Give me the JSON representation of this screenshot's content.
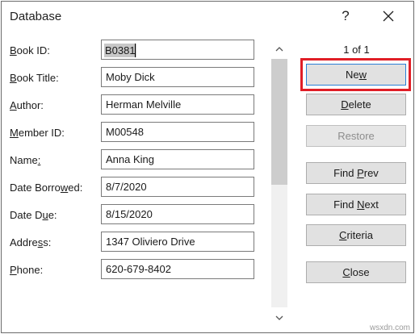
{
  "window": {
    "title": "Database",
    "help_glyph": "?"
  },
  "fields": [
    {
      "label_pre": "",
      "label_key": "B",
      "label_post": "ook ID:",
      "value": "B0381"
    },
    {
      "label_pre": "",
      "label_key": "B",
      "label_post": "ook Title:",
      "value": "Moby Dick"
    },
    {
      "label_pre": "",
      "label_key": "A",
      "label_post": "uthor:",
      "value": "Herman Melville"
    },
    {
      "label_pre": "",
      "label_key": "M",
      "label_post": "ember ID:",
      "value": "M00548"
    },
    {
      "label_pre": "Name",
      "label_key": ":",
      "label_post": "",
      "value": "Anna King"
    },
    {
      "label_pre": "Date Borro",
      "label_key": "w",
      "label_post": "ed:",
      "value": "8/7/2020"
    },
    {
      "label_pre": "Date D",
      "label_key": "u",
      "label_post": "e:",
      "value": "8/15/2020"
    },
    {
      "label_pre": "Addre",
      "label_key": "s",
      "label_post": "s:",
      "value": "1347 Oliviero Drive"
    },
    {
      "label_pre": "",
      "label_key": "P",
      "label_post": "hone:",
      "value": "620-679-8402"
    }
  ],
  "record_count": "1 of 1",
  "buttons": {
    "new": {
      "pre": "Ne",
      "key": "w",
      "post": ""
    },
    "delete": {
      "pre": "",
      "key": "D",
      "post": "elete"
    },
    "restore": {
      "pre": "",
      "key": "R",
      "post": "estore"
    },
    "find_prev": {
      "pre": "Find ",
      "key": "P",
      "post": "rev"
    },
    "find_next": {
      "pre": "Find ",
      "key": "N",
      "post": "ext"
    },
    "criteria": {
      "pre": "",
      "key": "C",
      "post": "riteria"
    },
    "close": {
      "pre": "",
      "key": "C",
      "post": "lose"
    }
  },
  "watermark": "wsxdn.com",
  "colors": {
    "highlight": "#e01e26",
    "button_face": "#e1e1e1",
    "selection": "#c7c7c7"
  },
  "icons": {
    "close": "close-icon",
    "scroll_up": "chevron-up-icon",
    "scroll_down": "chevron-down-icon"
  }
}
